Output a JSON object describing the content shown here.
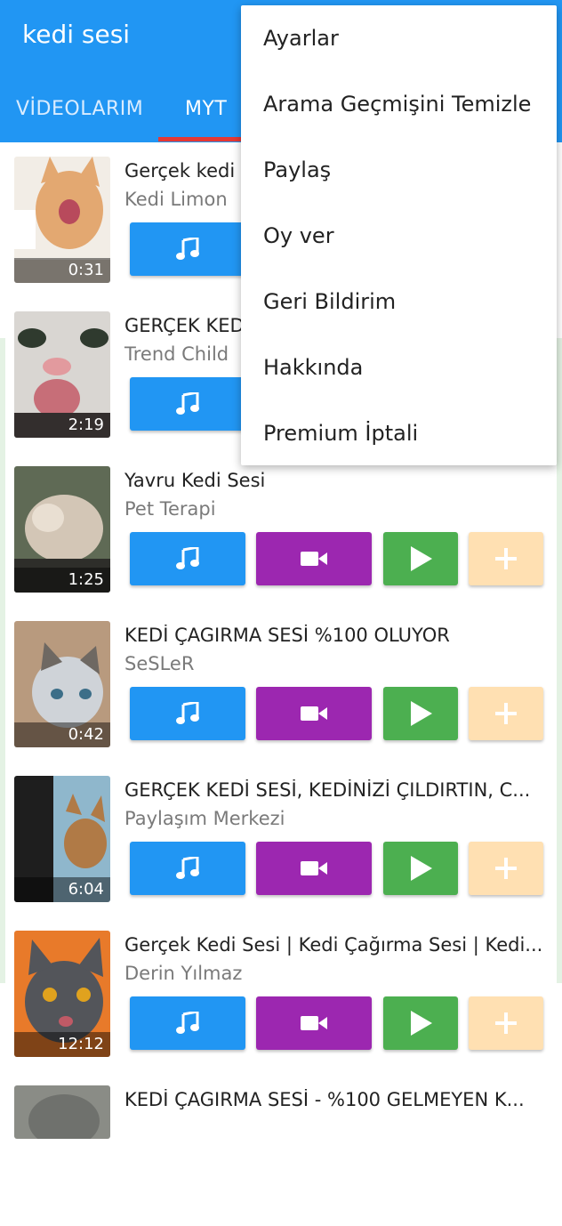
{
  "app": {
    "title": "kedi sesi"
  },
  "tabs": [
    {
      "label": "VİDEOLARIM"
    },
    {
      "label": "MYT"
    }
  ],
  "colors": {
    "primary": "#2196f3",
    "accent": "#e53935",
    "music": "#2196f3",
    "video": "#9c27b0",
    "play": "#4caf50",
    "add": "#ffe0b2"
  },
  "menu": {
    "items": [
      {
        "label": "Ayarlar"
      },
      {
        "label": "Arama Geçmişini Temizle"
      },
      {
        "label": "Paylaş"
      },
      {
        "label": "Oy ver"
      },
      {
        "label": "Geri Bildirim"
      },
      {
        "label": "Hakkında"
      },
      {
        "label": "Premium İptali"
      }
    ]
  },
  "buttons": {
    "music_icon": "music-note-icon",
    "video_icon": "video-camera-icon",
    "play_icon": "play-icon",
    "add_icon": "plus-icon"
  },
  "videos": [
    {
      "title": "Gerçek kedi sesi",
      "channel": "Kedi Limon",
      "duration": "0:31"
    },
    {
      "title": "GERÇEK KEDİ SESİ",
      "channel": "Trend Child",
      "duration": "2:19"
    },
    {
      "title": "Yavru Kedi Sesi",
      "channel": "Pet Terapi",
      "duration": "1:25"
    },
    {
      "title": "KEDİ ÇAGIRMA SESİ %100 OLUYOR",
      "channel": "SeSLeR",
      "duration": "0:42"
    },
    {
      "title": "GERÇEK KEDİ SESİ, KEDİNİZİ ÇILDIRTIN, C...",
      "channel": "Paylaşım Merkezi",
      "duration": "6:04"
    },
    {
      "title": "Gerçek Kedi Sesi | Kedi Çağırma Sesi | Kedi...",
      "channel": "Derin Yılmaz",
      "duration": "12:12"
    },
    {
      "title": "KEDİ ÇAGIRMA SESİ - %100 GELMEYEN K...",
      "channel": "",
      "duration": ""
    }
  ]
}
